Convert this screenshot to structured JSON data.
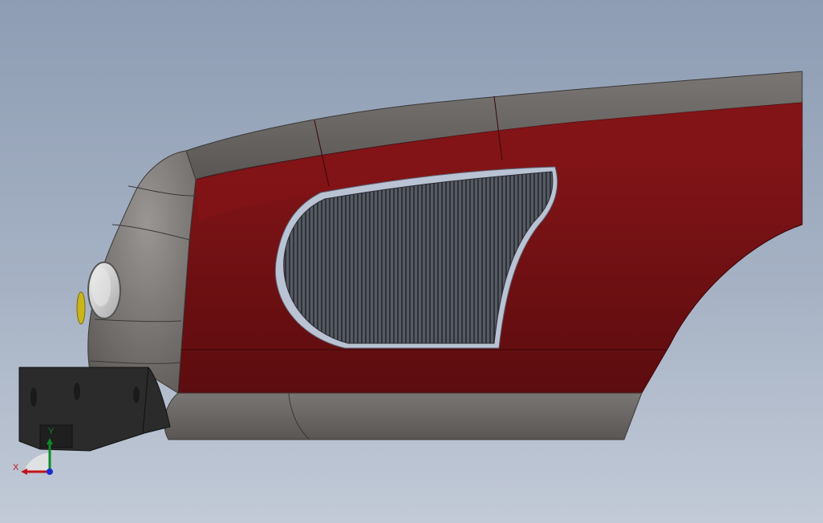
{
  "scene": {
    "description_colors": {
      "background_top": "#8e9db4",
      "background_bottom": "#c2cad7",
      "body_paint": "#7a1216",
      "body_paint_dark": "#5e0d10",
      "grey_trim": "#6e6a68",
      "grille_slats": "#3a3d44",
      "grille_frame": "#b9c3d3",
      "bumper": "#2a2a2a",
      "headlight_lens": "#d8d8d8",
      "turn_signal": "#c9b51a"
    }
  },
  "triad": {
    "x_label": "X",
    "y_label": "Y",
    "x_color": "#c0141c",
    "y_color": "#0a8a2a",
    "z_color": "#1a2ad0"
  }
}
